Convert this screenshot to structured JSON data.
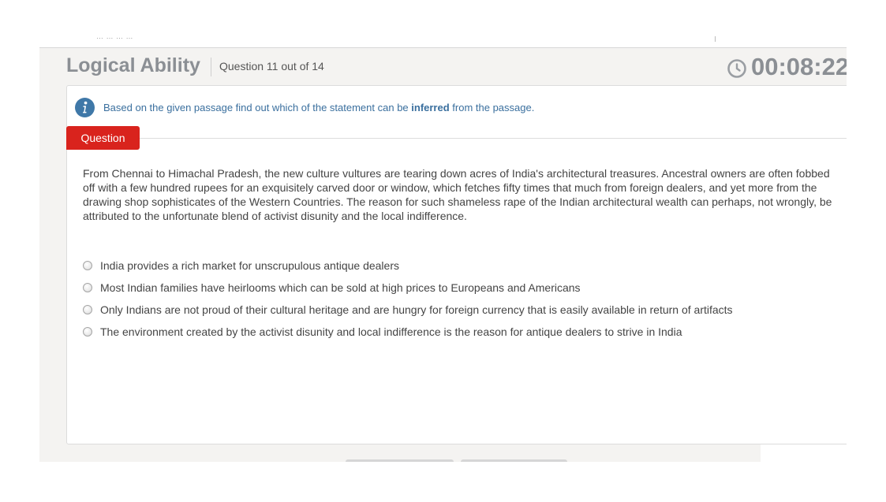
{
  "header": {
    "title": "Logical Ability",
    "question_counter": "Question 11 out of 14",
    "timer": "00:08:22"
  },
  "top_strip": {
    "partial_text": "… … … …"
  },
  "instruction": {
    "prefix": "Based on the given passage find out which of the statement can be ",
    "emphasis": "inferred",
    "suffix": " from the passage."
  },
  "question_tab": {
    "label": "Question"
  },
  "passage": "From Chennai to Himachal Pradesh, the new culture vultures are tearing down acres of India's architectural treasures. Ancestral owners are often fobbed off with a few hundred rupees for an exquisitely carved door or window, which fetches fifty times that much from foreign dealers, and yet more from the drawing shop sophisticates of the Western Countries. The reason for such shameless rape of the Indian architectural wealth can perhaps, not wrongly, be attributed to the unfortunate blend of activist disunity and the local indifference.",
  "options": [
    {
      "label": "India provides a rich market for unscrupulous antique dealers",
      "selected": false
    },
    {
      "label": "Most Indian families have heirlooms which can be sold at high prices to Europeans and Americans",
      "selected": false
    },
    {
      "label": "Only Indians are not proud of their cultural heritage and are hungry for foreign currency that is easily available in return of artifacts",
      "selected": false
    },
    {
      "label": "The environment created by the activist disunity and local indifference is the reason for antique dealers to strive in India",
      "selected": false
    }
  ],
  "icons": {
    "info": "info-icon",
    "timer": "clock-icon"
  },
  "colors": {
    "accent_red": "#d9231d",
    "instruction_blue": "#3a6f9e",
    "heading_gray": "#8b8f94"
  }
}
